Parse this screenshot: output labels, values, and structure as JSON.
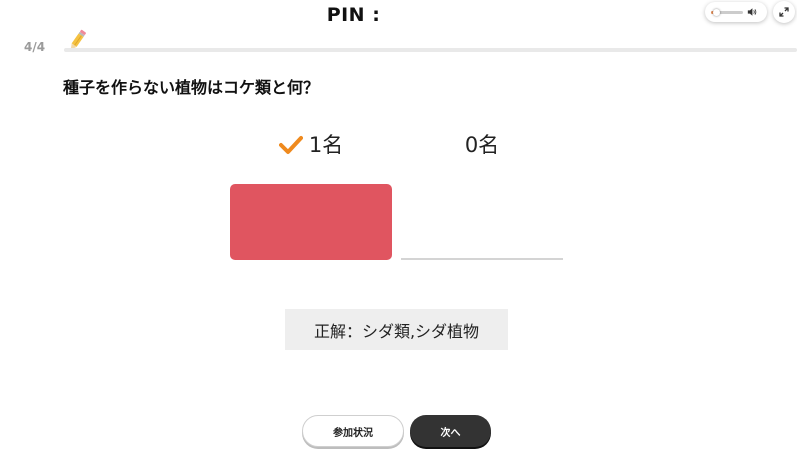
{
  "header": {
    "pin_label": "PIN :"
  },
  "controls": {
    "volume_level": 0.15,
    "accent_color": "#e8915a"
  },
  "progress": {
    "label": "4/4",
    "current": 4,
    "total": 4
  },
  "question": {
    "text": "種子を作らない植物はコケ類と何？"
  },
  "results": {
    "items": [
      {
        "count_label": "1名",
        "count": 1,
        "correct": true,
        "bar_color": "#e05560"
      },
      {
        "count_label": "0名",
        "count": 0,
        "correct": false,
        "bar_color": "#e05560"
      }
    ]
  },
  "answer": {
    "text": "正解：シダ類,シダ植物"
  },
  "buttons": {
    "status_label": "参加状況",
    "next_label": "次へ"
  }
}
